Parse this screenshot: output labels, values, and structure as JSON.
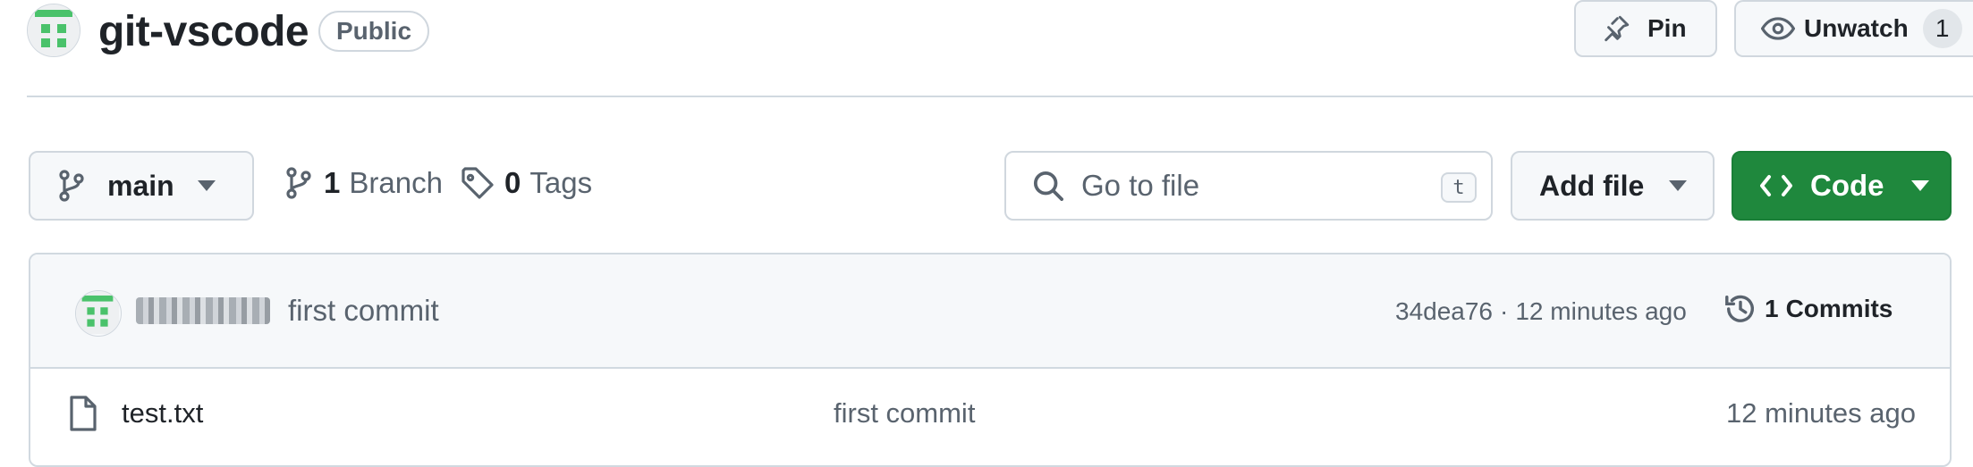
{
  "repo": {
    "name": "git-vscode",
    "visibility": "Public"
  },
  "header_actions": {
    "pin_label": "Pin",
    "unwatch_label": "Unwatch",
    "watch_count": "1"
  },
  "toolbar": {
    "branch_name": "main",
    "branch_count": "1",
    "branch_label": "Branch",
    "tag_count": "0",
    "tag_label": "Tags",
    "search_placeholder": "Go to file",
    "search_shortcut": "t",
    "add_file_label": "Add file",
    "code_label": "Code"
  },
  "latest_commit": {
    "message": "first commit",
    "hash": "34dea76",
    "separator": "·",
    "time": "12 minutes ago",
    "commits_count": "1",
    "commits_label": "Commits"
  },
  "files": [
    {
      "name": "test.txt",
      "message": "first commit",
      "time": "12 minutes ago"
    }
  ],
  "colors": {
    "accent_green": "#1f883d",
    "identicon_green": "#4ac26b",
    "border": "#d0d7de",
    "muted_text": "#59636e"
  }
}
